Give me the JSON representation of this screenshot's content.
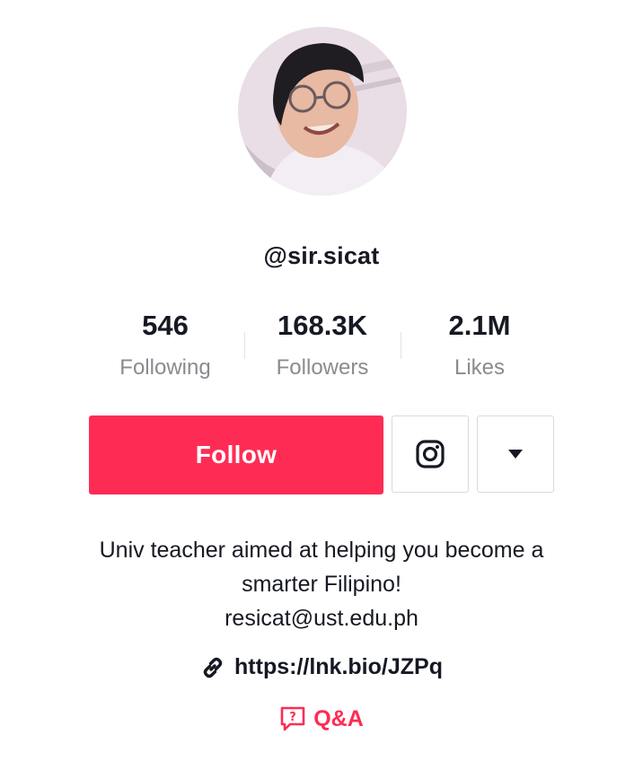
{
  "profile": {
    "username": "@sir.sicat"
  },
  "stats": [
    {
      "value": "546",
      "label": "Following"
    },
    {
      "value": "168.3K",
      "label": "Followers"
    },
    {
      "value": "2.1M",
      "label": "Likes"
    }
  ],
  "actions": {
    "follow_label": "Follow",
    "instagram_icon": "instagram-icon",
    "more_icon": "caret-down-icon"
  },
  "bio": {
    "line1": "Univ teacher aimed at helping you become a",
    "line2": "smarter Filipino!",
    "line3": "resicat@ust.edu.ph"
  },
  "link": {
    "icon": "link-icon",
    "text": "https://lnk.bio/JZPq"
  },
  "qa": {
    "icon": "question-bubble-icon",
    "label": "Q&A"
  },
  "colors": {
    "accent": "#fe2c55",
    "text": "#161823",
    "muted": "#8a8b91"
  }
}
